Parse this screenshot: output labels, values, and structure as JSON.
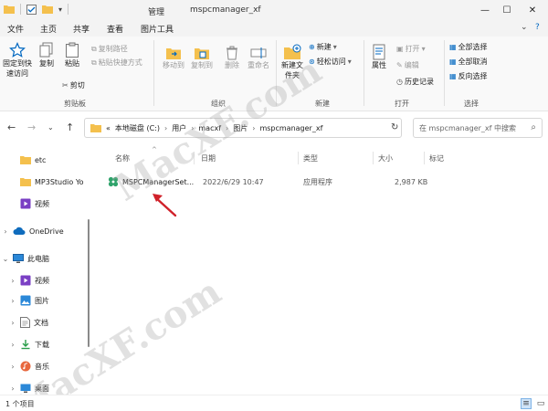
{
  "titlebar": {
    "context_tab": "管理",
    "window_title": "mspcmanager_xf"
  },
  "menu": {
    "tabs": [
      "文件",
      "主页",
      "共享",
      "查看",
      "图片工具"
    ]
  },
  "ribbon": {
    "clipboard": {
      "pin_quick_access": "固定到快速访问",
      "copy": "复制",
      "paste": "粘贴",
      "copy_path": "复制路径",
      "paste_shortcut": "粘贴快捷方式",
      "cut": "剪切",
      "label": "剪贴板"
    },
    "organize": {
      "move_to": "移动到",
      "copy_to": "复制到",
      "delete": "删除",
      "rename": "重命名",
      "label": "组织"
    },
    "new": {
      "new_folder": "新建文件夹",
      "new_item": "新建",
      "easy_access": "轻松访问",
      "label": "新建"
    },
    "open": {
      "properties": "属性",
      "open": "打开",
      "edit": "编辑",
      "history": "历史记录",
      "label": "打开"
    },
    "select": {
      "select_all": "全部选择",
      "select_none": "全部取消",
      "invert": "反向选择",
      "label": "选择"
    }
  },
  "address": {
    "path": [
      "«",
      "本地磁盘 (C:)",
      "用户",
      "macxf",
      "图片",
      "mspcmanager_xf"
    ],
    "search_placeholder": "在 mspcmanager_xf 中搜索"
  },
  "nav": {
    "items": [
      {
        "label": "etc",
        "icon": "folder-icon"
      },
      {
        "label": "MP3Studio Yo",
        "icon": "folder-icon"
      },
      {
        "label": "视频",
        "icon": "video-icon"
      },
      {
        "label": "OneDrive",
        "icon": "cloud-icon"
      },
      {
        "label": "此电脑",
        "icon": "pc-icon"
      },
      {
        "label": "视频",
        "icon": "video-icon"
      },
      {
        "label": "图片",
        "icon": "picture-icon"
      },
      {
        "label": "文档",
        "icon": "document-icon"
      },
      {
        "label": "下载",
        "icon": "download-icon"
      },
      {
        "label": "音乐",
        "icon": "music-icon"
      },
      {
        "label": "桌面",
        "icon": "desktop-icon"
      }
    ]
  },
  "columns": {
    "name": "名称",
    "date": "日期",
    "type": "类型",
    "size": "大小",
    "tags": "标记"
  },
  "files": [
    {
      "name": "MSPCManagerSet...",
      "date": "2022/6/29 10:47",
      "type": "应用程序",
      "size": "2,987 KB"
    }
  ],
  "status": {
    "count": "1 个项目"
  },
  "watermark": [
    "MacXF.com",
    "MacXF.com"
  ],
  "colors": {
    "accent": "#0067c0",
    "folder": "#f4c04d",
    "arrow": "#d0212a"
  }
}
